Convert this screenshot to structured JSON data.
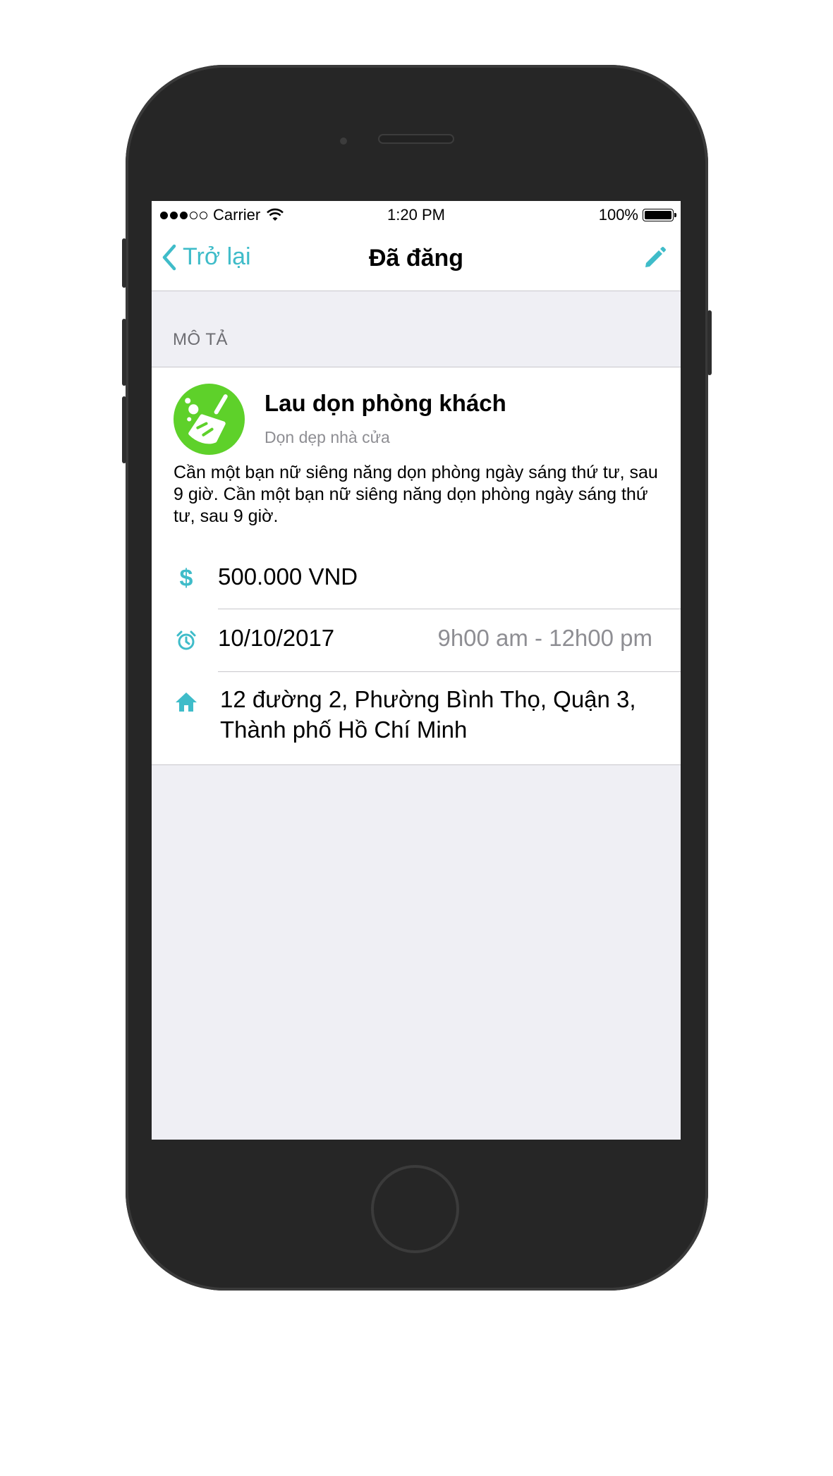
{
  "status_bar": {
    "carrier": "Carrier",
    "time": "1:20 PM",
    "battery": "100%",
    "signal_bars_filled": 3,
    "signal_bars_total": 5
  },
  "nav": {
    "back_label": "Trở lại",
    "title": "Đã đăng",
    "edit_icon": "pencil-icon"
  },
  "section": {
    "header": "MÔ TẢ"
  },
  "job": {
    "icon": "broom-icon",
    "icon_color": "#5ed12a",
    "title": "Lau dọn phòng khách",
    "category": "Dọn dẹp nhà cửa",
    "description": "Cần một bạn nữ siêng năng dọn phòng ngày sáng thứ tư, sau 9 giờ. Cần một bạn nữ siêng năng dọn phòng ngày sáng thứ tư, sau 9 giờ."
  },
  "details": {
    "price_icon": "dollar-icon",
    "price": "500.000 VND",
    "date_icon": "alarm-clock-icon",
    "date": "10/10/2017",
    "time_range": "9h00 am - 12h00 pm",
    "address_icon": "home-icon",
    "address_line1": "12 đường 2, Phường Bình Thọ, Quận 3,",
    "address_line2": "Thành phố Hồ Chí Minh"
  },
  "colors": {
    "accent": "#3fbcc9",
    "background": "#efeff4"
  }
}
